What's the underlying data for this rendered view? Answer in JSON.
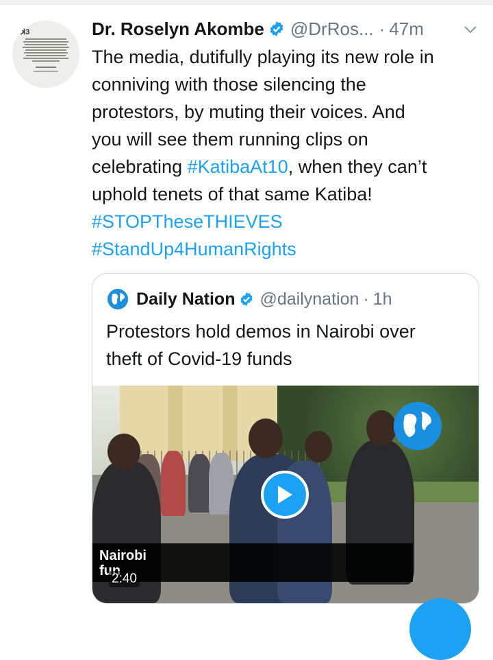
{
  "tweet": {
    "author": {
      "display_name": "Dr. Roselyn Akombe",
      "handle": "@DrRos...",
      "verified": true,
      "avatar_logo": "ꓘ3"
    },
    "separator": "·",
    "time": "47m",
    "text": {
      "line1": "The media, dutifully playing its new role in",
      "line2": "conniving with those silencing the",
      "line3": "protestors, by muting their voices. And",
      "line4": "you will see them running clips on",
      "line5_before": "celebrating ",
      "hashtag1": "#KatibaAt10",
      "line5_after": ", when they can’t",
      "line6": "uphold tenets of that same Katiba!",
      "hashtag2": "#STOPTheseTHIEVES",
      "hashtag3": "#StandUp4HumanRights"
    }
  },
  "quote": {
    "author": {
      "display_name": "Daily Nation",
      "handle": "@dailynation",
      "verified": true
    },
    "separator": "·",
    "time": "1h",
    "text_line1": "Protestors hold demos in Nairobi over",
    "text_line2": "theft of Covid-19 funds",
    "media": {
      "caption_line1": "Nairobi",
      "caption_line2": "fun",
      "duration": "2:40"
    }
  },
  "colors": {
    "accent": "#1da1f2",
    "text": "#14171a",
    "secondary": "#657786",
    "border": "#ccd6dd"
  },
  "icons": [
    "verified-badge-icon",
    "chevron-down-icon",
    "play-icon",
    "globe-logo-icon",
    "compose-fab"
  ]
}
